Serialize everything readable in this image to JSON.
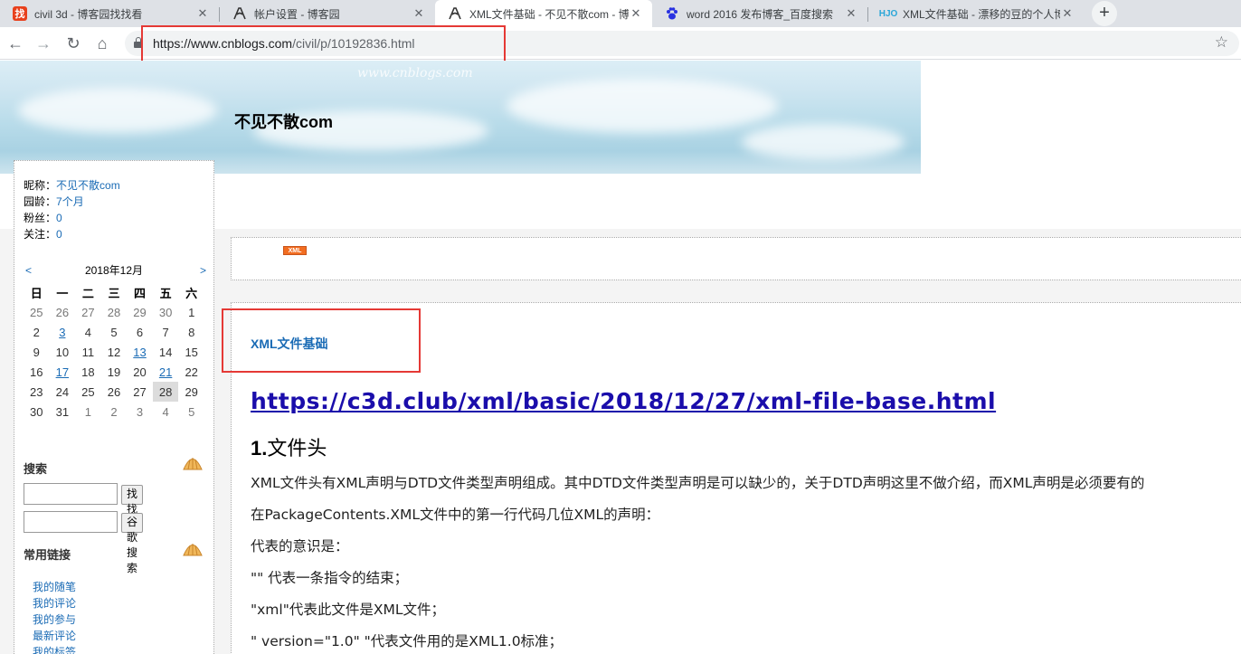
{
  "tabs": [
    {
      "title": "civil 3d - 博客园找找看",
      "icon": "zhao-icon"
    },
    {
      "title": "帐户设置 - 博客园",
      "icon": "cnblogs-icon"
    },
    {
      "title": "XML文件基础 - 不见不散com - 博",
      "icon": "cnblogs-icon",
      "active": true
    },
    {
      "title": "word 2016 发布博客_百度搜索",
      "icon": "baidu-paw-icon"
    },
    {
      "title": "XML文件基础 - 漂移的豆的个人博",
      "icon": "hjo-icon"
    }
  ],
  "toolbar": {
    "url_host": "https://www.cnblogs.com",
    "url_path": "/civil/p/10192836.html"
  },
  "blog": {
    "title": "不见不散com",
    "watermark": "www.cnblogs.com"
  },
  "sidebar": {
    "nickname_label": "昵称：",
    "nickname": "不见不散com",
    "age_label": "园龄：",
    "age": "7个月",
    "fans_label": "粉丝：",
    "fans": "0",
    "follow_label": "关注：",
    "follow": "0",
    "calendar": {
      "prev": "<",
      "next": ">",
      "month": "2018年12月",
      "weekdays": [
        "日",
        "一",
        "二",
        "三",
        "四",
        "五",
        "六"
      ],
      "weeks": [
        [
          "25",
          "26",
          "27",
          "28",
          "29",
          "30",
          "1"
        ],
        [
          "2",
          "3",
          "4",
          "5",
          "6",
          "7",
          "8"
        ],
        [
          "9",
          "10",
          "11",
          "12",
          "13",
          "14",
          "15"
        ],
        [
          "16",
          "17",
          "18",
          "19",
          "20",
          "21",
          "22"
        ],
        [
          "23",
          "24",
          "25",
          "26",
          "27",
          "28",
          "29"
        ],
        [
          "30",
          "31",
          "1",
          "2",
          "3",
          "4",
          "5"
        ]
      ]
    },
    "search_title": "搜索",
    "search_button": "找找看",
    "google_button": "谷歌搜索",
    "links_title": "常用链接",
    "links": [
      "我的随笔",
      "我的评论",
      "我的参与",
      "最新评论",
      "我的标签"
    ]
  },
  "post": {
    "xml_badge": "XML",
    "title": "XML文件基础",
    "link": "https://c3d.club/xml/basic/2018/12/27/xml-file-base.html",
    "heading_num": "1.",
    "heading_text": "文件头",
    "paragraphs": [
      "XML文件头有XML声明与DTD文件类型声明组成。其中DTD文件类型声明是可以缺少的，关于DTD声明这里不做介绍，而XML声明是必须要有的",
      "在PackageContents.XML文件中的第一行代码几位XML的声明：",
      "代表的意识是：",
      "\"\" 代表一条指令的结束；",
      "\"xml\"代表此文件是XML文件；",
      "\" version=\"1.0\" \"代表文件用的是XML1.0标准；"
    ]
  }
}
